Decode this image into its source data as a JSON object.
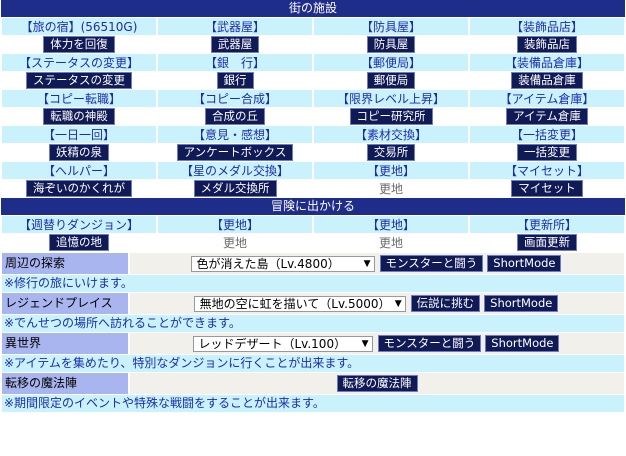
{
  "town": {
    "title": "街の施設",
    "rows": [
      {
        "headers": [
          "【旅の宿】(56510G)",
          "【武器屋】",
          "【防具屋】",
          "【装飾品店】"
        ],
        "buttons": [
          "体力を回復",
          "武器屋",
          "防具屋",
          "装飾品店"
        ]
      },
      {
        "headers": [
          "【ステータスの変更】",
          "【銀　行】",
          "【郵便局】",
          "【装備品倉庫】"
        ],
        "buttons": [
          "ステータスの変更",
          "銀行",
          "郵便局",
          "装備品倉庫"
        ]
      },
      {
        "headers": [
          "【コピー転職】",
          "【コピー合成】",
          "【限界レベル上昇】",
          "【アイテム倉庫】"
        ],
        "buttons": [
          "転職の神殿",
          "合成の丘",
          "コピー研究所",
          "アイテム倉庫"
        ]
      },
      {
        "headers": [
          "【一日一回】",
          "【意見・感想】",
          "【素材交換】",
          "【一括変更】"
        ],
        "buttons": [
          "妖精の泉",
          "アンケートボックス",
          "交易所",
          "一括変更"
        ]
      },
      {
        "headers": [
          "【ヘルパー】",
          "【星のメダル交換】",
          "【更地】",
          "【マイセット】"
        ],
        "buttons": [
          "海ぞいのかくれが",
          "メダル交換所",
          "更地",
          "マイセット"
        ],
        "plain": [
          false,
          false,
          true,
          false
        ]
      }
    ]
  },
  "adventure": {
    "title": "冒険に出かける",
    "headers": [
      "【週替りダンジョン】",
      "【更地】",
      "【更地】",
      "【更新所】"
    ],
    "buttons": [
      "追憶の地",
      "更地",
      "更地",
      "画面更新"
    ],
    "plain": [
      false,
      true,
      true,
      false
    ],
    "explore": {
      "label": "周辺の探索",
      "select": "色が消えた島（Lv.4800）",
      "action": "モンスターと闘う",
      "short": "ShortMode",
      "note": "※修行の旅にいけます。"
    },
    "legend": {
      "label": "レジェンドプレイス",
      "select": "無地の空に虹を描いて（Lv.5000）",
      "action": "伝説に挑む",
      "short": "ShortMode",
      "note": "※でんせつの場所へ訪れることができます。"
    },
    "otherworld": {
      "label": "異世界",
      "select": "レッドデザート（Lv.100）",
      "action": "モンスターと闘う",
      "short": "ShortMode",
      "note": "※アイテムを集めたり、特別なダンジョンに行くことが出来ます。"
    },
    "teleport": {
      "label": "転移の魔法陣",
      "action": "転移の魔法陣",
      "note": "※期間限定のイベントや特殊な戦闘をすることが出来ます。"
    }
  }
}
